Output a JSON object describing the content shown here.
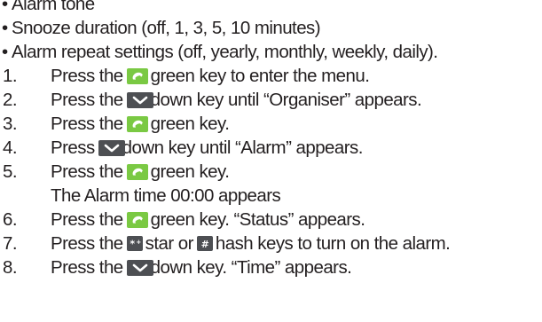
{
  "bullets": [
    "Alarm tone",
    "Snooze duration (off, 1, 3, 5, 10 minutes)",
    "Alarm repeat settings (off, yearly, monthly, weekly, daily)."
  ],
  "bullet_symbol": "•",
  "steps": [
    {
      "num": "1.",
      "pre": "Press the",
      "key": "green-key-icon",
      "post": "green key to enter the menu."
    },
    {
      "num": "2.",
      "pre": "Press the",
      "key": "down-key-icon",
      "post": "down key until “Organiser” appears."
    },
    {
      "num": "3.",
      "pre": "Press the",
      "key": "green-key-icon",
      "post": "green key."
    },
    {
      "num": "4.",
      "pre": "Press",
      "key": "down-key-icon",
      "post": "down key until “Alarm” appears."
    },
    {
      "num": "5.",
      "pre": "Press the",
      "key": "green-key-icon",
      "post": "green key.",
      "continuation": "The Alarm time 00:00 appears"
    },
    {
      "num": "6.",
      "pre": "Press the",
      "key": "green-key-icon",
      "post": "green key. “Status” appears."
    },
    {
      "num": "7.",
      "pre": "Press the",
      "key": "star-key-icon",
      "mid": "star or",
      "key2": "hash-key-icon",
      "post": "hash keys to turn on the alarm."
    },
    {
      "num": "8.",
      "pre": "Press the",
      "key": "down-key-icon",
      "post": "down key. “Time” appears."
    }
  ],
  "colors": {
    "text": "#231f20",
    "green_key": "#7ac943",
    "dark_key": "#4d4f53"
  }
}
